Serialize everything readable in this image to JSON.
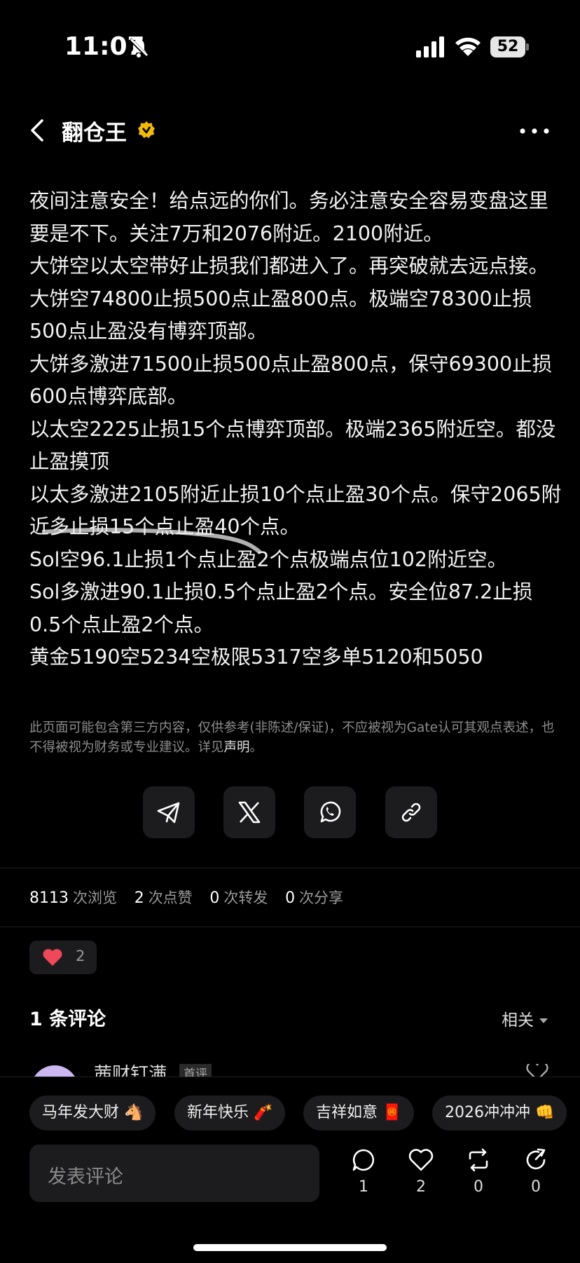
{
  "status_bar": {
    "time": "11:07",
    "battery": "52"
  },
  "header": {
    "author": "翻仓王"
  },
  "post": {
    "paragraphs": [
      "夜间注意安全！给点远的你们。务必注意安全容易变盘这里要是不下。关注7万和2076附近。2100附近。",
      "大饼空以太空带好止损我们都进入了。再突破就去远点接。",
      "大饼空74800止损500点止盈800点。极端空78300止损500点止盈没有博弈顶部。",
      "大饼多激进71500止损500点止盈800点，保守69300止损600点博弈底部。",
      "以太空2225止损15个点博弈顶部。极端2365附近空。都没止盈摸顶",
      "以太多激进2105附近止损10个点止盈30个点。保守2065附近多止损15个点止盈40个点。",
      "Sol空96.1止损1个点止盈2个点极端点位102附近空。",
      "Sol多激进90.1止损0.5个点止盈2个点。安全位87.2止损0.5个点止盈2个点。",
      "黄金5190空5234空极限5317空多单5120和5050"
    ],
    "disclaimer": "此页面可能包含第三方内容，仅供参考(非陈述/保证)，不应被视为Gate认可其观点表述，也不得被视为财务或专业建议。详见",
    "disclaimer_link": "声明",
    "disclaimer_end": "。"
  },
  "share": {
    "buttons": [
      {
        "icon": "telegram-icon"
      },
      {
        "icon": "x-icon"
      },
      {
        "icon": "whatsapp-icon"
      },
      {
        "icon": "link-icon"
      }
    ]
  },
  "stats": {
    "views": "8113",
    "views_label": "次浏览",
    "likes": "2",
    "likes_label": "次点赞",
    "reposts": "0",
    "reposts_label": "次转发",
    "shares": "0",
    "shares_label": "次分享"
  },
  "like_pill": {
    "count": "2"
  },
  "comments": {
    "header": "1 条评论",
    "sort": "相关",
    "first_commenter": "茜财钉满",
    "first_commenter_tag": "首评"
  },
  "quick_replies": [
    "马年发大财 🐴",
    "新年快乐 🧨",
    "吉祥如意 🧧",
    "2026冲冲冲 👊"
  ],
  "bottom_bar": {
    "input_placeholder": "发表评论",
    "comment_count": "1",
    "like_count": "2",
    "repost_count": "0",
    "share_count": "0"
  },
  "colors": {
    "background": "#000000",
    "verified": "#f0b90b",
    "like_heart": "#f0485b",
    "surface": "#1c1c1e"
  }
}
